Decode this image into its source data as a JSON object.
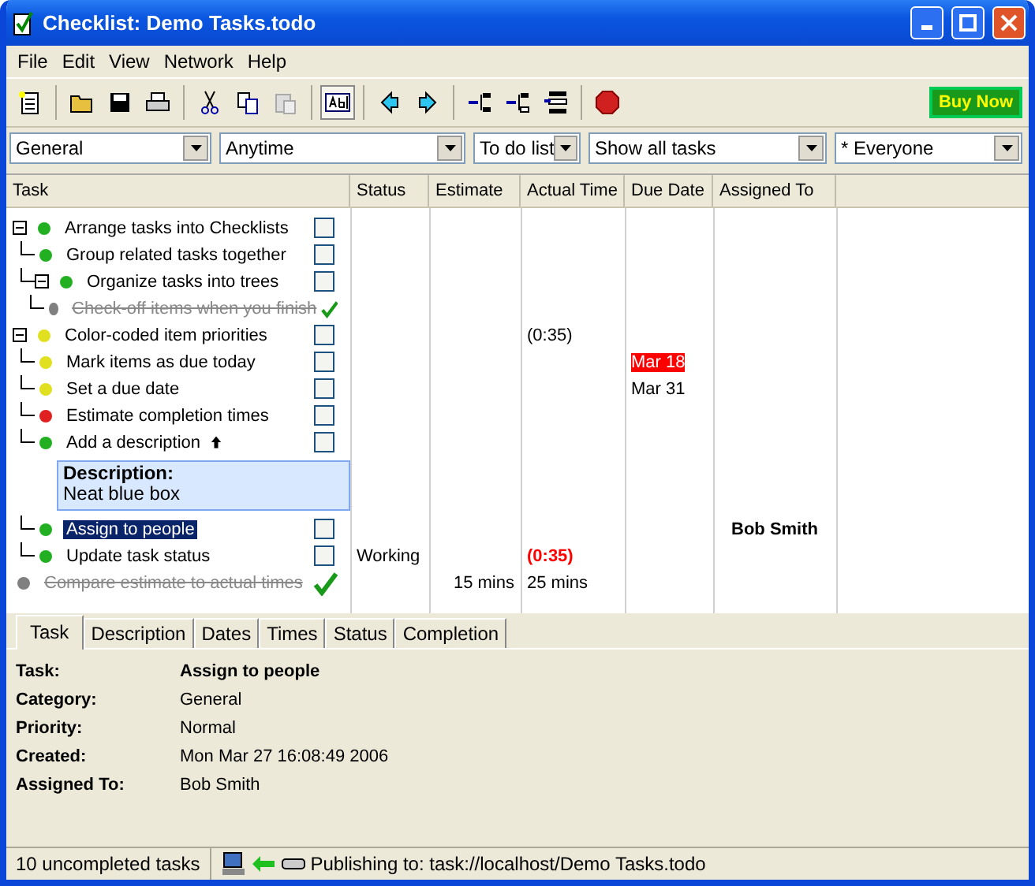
{
  "window": {
    "title": "Checklist: Demo Tasks.todo"
  },
  "menu": [
    "File",
    "Edit",
    "View",
    "Network",
    "Help"
  ],
  "toolbar": {
    "buy_button": "Buy Now"
  },
  "filters": [
    {
      "value": "General"
    },
    {
      "value": "Anytime"
    },
    {
      "value": "To do list"
    },
    {
      "value": "Show all tasks"
    },
    {
      "value": "* Everyone"
    }
  ],
  "columns": [
    "Task",
    "Status",
    "Estimate",
    "Actual Time",
    "Due Date",
    "Assigned To"
  ],
  "tasks": [
    {
      "name": "Arrange tasks into Checklists",
      "color": "#22b022",
      "checked": false,
      "selected": false,
      "expanded": true,
      "children": [
        {
          "name": "Group related tasks together",
          "color": "#22b022",
          "checked": false,
          "selected": false
        },
        {
          "name": "Organize tasks into trees",
          "color": "#22b022",
          "checked": false,
          "selected": false,
          "expanded": true,
          "children": [
            {
              "name": "Check-off items when you finish",
              "color": "#808080",
              "checked": true,
              "selected": false
            }
          ]
        }
      ]
    },
    {
      "name": "Color-coded item priorities",
      "color": "#e0e020",
      "checked": false,
      "selected": false,
      "expanded": true,
      "actual_time": {
        "text": "(0:35)",
        "overdue": false
      },
      "children": [
        {
          "name": "Mark items as due today",
          "color": "#e0e020",
          "checked": false,
          "selected": false,
          "due_date": {
            "text": "Mar 18",
            "overdue": true
          }
        },
        {
          "name": "Set a due date",
          "color": "#e0e020",
          "checked": false,
          "selected": false,
          "due_date": {
            "text": "Mar 31",
            "overdue": false
          }
        },
        {
          "name": "Estimate completion times",
          "color": "#e02020",
          "checked": false,
          "selected": false
        },
        {
          "name": "Add a description",
          "color": "#22b022",
          "checked": false,
          "selected": false,
          "description": {
            "label": "Description:",
            "text": "Neat blue box"
          }
        },
        {
          "name": "Assign to people",
          "color": "#22b022",
          "checked": false,
          "selected": true,
          "assigned_to": "Bob Smith"
        },
        {
          "name": "Update task status",
          "color": "#22b022",
          "checked": false,
          "selected": false,
          "status": "Working",
          "actual_time": {
            "text": "(0:35)",
            "overdue": true
          }
        }
      ]
    },
    {
      "name": "Compare estimate to actual times",
      "color": "#808080",
      "checked": true,
      "selected": false,
      "estimate": "15 mins",
      "actual_time": {
        "text": "25 mins",
        "overdue": false
      }
    }
  ],
  "detail_tabs": [
    {
      "label": "Task",
      "selected": true
    },
    {
      "label": "Description",
      "selected": false
    },
    {
      "label": "Dates",
      "selected": false
    },
    {
      "label": "Times",
      "selected": false
    },
    {
      "label": "Status",
      "selected": false
    },
    {
      "label": "Completion",
      "selected": false
    }
  ],
  "details": [
    {
      "label": "Task:",
      "value": "Assign to people",
      "bold": true
    },
    {
      "label": "Category:",
      "value": "General",
      "bold": false
    },
    {
      "label": "Priority:",
      "value": "Normal",
      "bold": false
    },
    {
      "label": "Created:",
      "value": "Mon Mar 27 16:08:49 2006",
      "bold": false
    },
    {
      "label": "Assigned To:",
      "value": "Bob Smith",
      "bold": false
    }
  ],
  "status_bar": {
    "count": "10 uncompleted tasks",
    "publishing": "Publishing to: task://localhost/Demo Tasks.todo"
  }
}
